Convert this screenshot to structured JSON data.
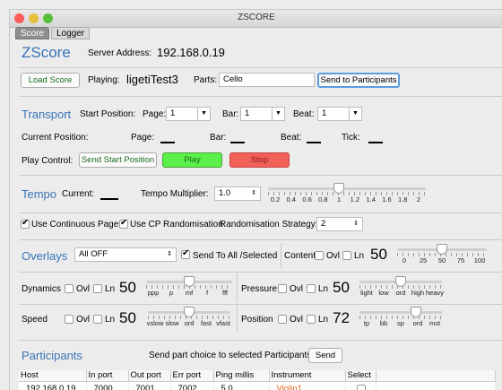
{
  "window": {
    "title": "ZSCORE",
    "tabs": [
      {
        "label": "Score",
        "selected": true
      },
      {
        "label": "Logger",
        "selected": false
      }
    ]
  },
  "header": {
    "app_name": "ZScore",
    "server_label": "Server Address:",
    "server_value": "192.168.0.19",
    "load_button": "Load Score",
    "playing_label": "Playing:",
    "playing_value": "ligetiTest3",
    "parts_label": "Parts:",
    "parts_value": "Cello",
    "send_button": "Send to Participants"
  },
  "transport": {
    "title": "Transport",
    "start_label": "Start Position:",
    "page_label": "Page:",
    "page_value": "1",
    "bar_label": "Bar:",
    "bar_value": "1",
    "beat_label": "Beat:",
    "beat_value": "1",
    "current_label": "Current Position:",
    "cur_page": "Page:",
    "cur_bar": "Bar:",
    "cur_beat": "Beat:",
    "cur_tick": "Tick:",
    "play_control_label": "Play Control:",
    "send_start_button": "Send Start Position",
    "play_button": "Play",
    "stop_button": "Stop"
  },
  "tempo": {
    "title": "Tempo",
    "current_label": "Current:",
    "multiplier_label": "Tempo Multiplier:",
    "multiplier_value": "1.0",
    "slider_ticks": [
      "0.2",
      "0.4",
      "0.6",
      "0.8",
      "1",
      "1.2",
      "1.4",
      "1.6",
      "1.8",
      "2"
    ],
    "slider_value": 1.0
  },
  "options": {
    "continuous_page": {
      "label": "Use Continuous Page",
      "checked": true
    },
    "cp_random": {
      "label": "Use CP Randomisation",
      "checked": true
    },
    "strategy_label": "Randomisation Strategy:",
    "strategy_value": "2"
  },
  "overlays": {
    "title": "Overlays",
    "mode_value": "All OFF",
    "send_all": {
      "label": "Send To All /Selected",
      "checked": true
    },
    "content": {
      "label": "Content",
      "ovl": "Ovl",
      "ln": "Ln",
      "value": "50",
      "ticks": [
        "0",
        "25",
        "50",
        "75",
        "100"
      ],
      "slider_value": 50
    },
    "dynamics": {
      "label": "Dynamics",
      "ovl": "Ovl",
      "ln": "Ln",
      "value": "50",
      "ticks": [
        "ppp",
        "p",
        "mf",
        "f",
        "fff"
      ],
      "slider_value": 50
    },
    "pressure": {
      "label": "Pressure",
      "ovl": "Ovl",
      "ln": "Ln",
      "value": "50",
      "ticks": [
        "light",
        "low",
        "ord",
        "high",
        "heavy"
      ],
      "slider_value": 50
    },
    "speed": {
      "label": "Speed",
      "ovl": "Ovl",
      "ln": "Ln",
      "value": "50",
      "ticks": [
        "vslow",
        "slow",
        "ord",
        "fast",
        "vfast"
      ],
      "slider_value": 50
    },
    "position": {
      "label": "Position",
      "ovl": "Ovl",
      "ln": "Ln",
      "value": "72",
      "ticks": [
        "tp",
        "bb",
        "sp",
        "ord",
        "mst"
      ],
      "slider_value": 72
    }
  },
  "participants": {
    "title": "Participants",
    "send_label": "Send part choice to selected Participants:",
    "send_button": "Send",
    "columns": [
      "Host",
      "In port",
      "Out port",
      "Err port",
      "Ping millis",
      "Instrument",
      "Select"
    ],
    "rows": [
      {
        "host": "192.168.0.19",
        "in_port": "7000",
        "out_port": "7001",
        "err_port": "7002",
        "ping": "5.0",
        "instrument": "Violin1",
        "selected": false
      }
    ]
  },
  "colors": {
    "accent": "#3874b8",
    "play": "#5cf04a",
    "stop": "#f2605a",
    "instrument": "#d9621b"
  }
}
